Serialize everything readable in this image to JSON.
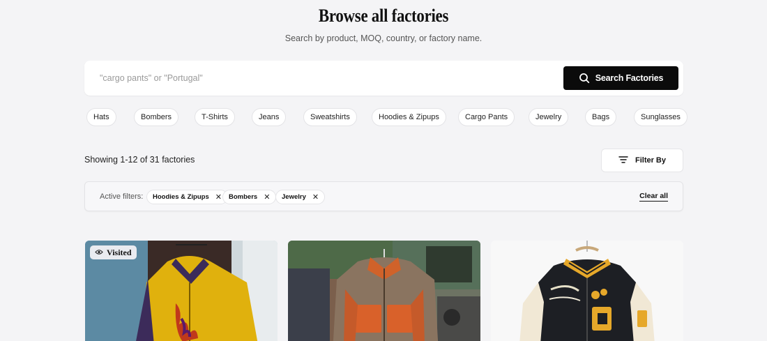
{
  "header": {
    "title": "Browse all factories",
    "subtitle": "Search by product, MOQ, country, or factory name."
  },
  "search": {
    "placeholder": "\"cargo pants\" or \"Portugal\"",
    "value": "",
    "button_label": "Search Factories",
    "button_icon": "search-icon"
  },
  "categories": [
    "Hats",
    "Bombers",
    "T-Shirts",
    "Jeans",
    "Sweatshirts",
    "Hoodies & Zipups",
    "Cargo Pants",
    "Jewelry",
    "Bags",
    "Sunglasses"
  ],
  "results": {
    "count_text": "Showing 1-12 of 31 factories",
    "filter_label": "Filter By",
    "filter_icon": "filter-lines-icon"
  },
  "active_filters": {
    "label": "Active filters:",
    "tags": [
      "Hoodies & Zipups",
      "Bombers",
      "Jewelry"
    ],
    "remove_icon": "close-icon",
    "clear_all": "Clear all"
  },
  "cards": [
    {
      "visited": true,
      "badge_label": "Visited",
      "badge_icon": "eye-icon",
      "image": "yellow-zip-jacket-photo"
    },
    {
      "visited": false,
      "image": "fleece-jacket-photo"
    },
    {
      "visited": false,
      "image": "varsity-jacket-photo"
    }
  ],
  "colors": {
    "primary_button": "#0b0b0b",
    "background": "#f4f4f6"
  }
}
